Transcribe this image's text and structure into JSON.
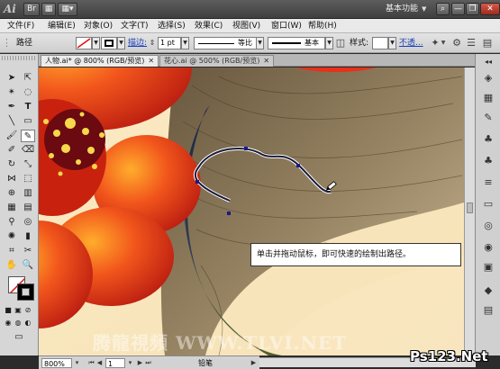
{
  "app": {
    "logo_text": "Ai",
    "workspace": "基本功能",
    "window_buttons": {
      "search": "⌕",
      "minimize": "—",
      "restore": "❐",
      "close": "✕"
    }
  },
  "menu": [
    "文件(F)",
    "编辑(E)",
    "对象(O)",
    "文字(T)",
    "选择(S)",
    "效果(C)",
    "视图(V)",
    "窗口(W)",
    "帮助(H)"
  ],
  "control_bar": {
    "object_type": "路径",
    "stroke_label": "描边:",
    "stroke_weight": "1 pt",
    "profile": "等比",
    "brush": "基本",
    "style_label": "样式:",
    "opacity_label": "不透..."
  },
  "tabs": [
    {
      "label": "人物.ai* @ 800% (RGB/预览)",
      "active": true
    },
    {
      "label": "花心.ai @ 500% (RGB/预览)",
      "active": false
    }
  ],
  "status_bar": {
    "zoom": "800%",
    "page": "1",
    "tool_name": "铅笔"
  },
  "callout_text": "单击并拖动鼠标，即可快速的绘制出路径。",
  "watermark_text": "腾龍視頻  WWW.TLVI.NET",
  "site_logo": "Ps123.Net",
  "colors": {
    "flower_red": "#e8301a",
    "flower_center": "#7a0e12",
    "hair": "#6b5a3e",
    "skin": "#f1dcb6",
    "path_stroke": "#1a1a3a"
  }
}
